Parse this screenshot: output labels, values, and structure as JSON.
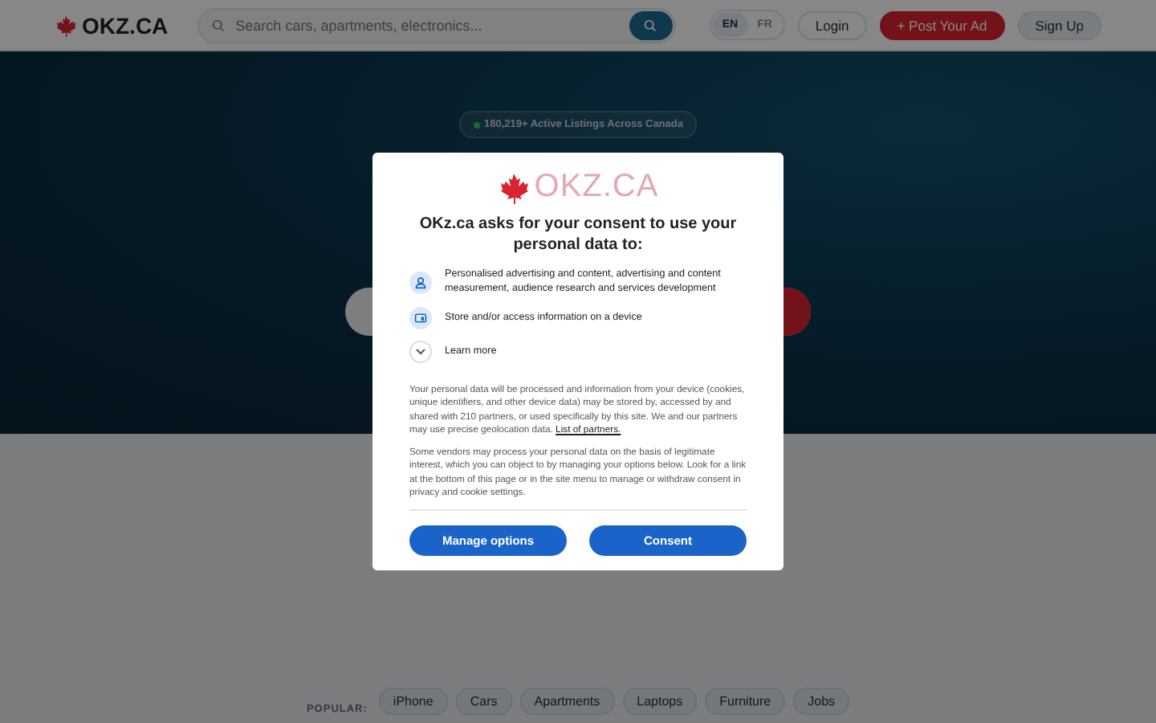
{
  "header": {
    "logo": "OKZ.CA",
    "search": {
      "placeholder": "Search cars, apartments, electronics..."
    },
    "languages": [
      {
        "label": "EN",
        "selected": true
      },
      {
        "label": "FR",
        "selected": false
      }
    ],
    "login": "Login",
    "post_ad": "+ Post Your Ad",
    "sign_up": "Sign Up"
  },
  "hero": {
    "badge": "180,219+ Active Listings Across Canada"
  },
  "popular": {
    "label": "POPULAR:",
    "tags": [
      "iPhone",
      "Cars",
      "Apartments",
      "Laptops",
      "Furniture",
      "Jobs"
    ]
  },
  "consent": {
    "logo": "OKZ.CA",
    "title": "OKz.ca asks for your consent to use your personal data to:",
    "purposes": [
      {
        "kind": "person",
        "text": "Personalised advertising and content, advertising and content measurement, audience research and services development"
      },
      {
        "kind": "device",
        "text": "Store and/or access information on a device"
      }
    ],
    "learn_more": "Learn more",
    "paragraph_1": "Your personal data will be processed and information from your device (cookies, unique identifiers, and other device data) may be stored by, accessed by and shared with 210 partners, or used specifically by this site. We and our partners may use precise geolocation data.",
    "partners_link": "List of partners.",
    "paragraph_2": "Some vendors may process your personal data on the basis of legitimate interest, which you can object to by managing your options below. Look for a link at the bottom of this page or in the site menu to manage or withdraw consent in privacy and cookie settings.",
    "buttons": [
      "Manage options",
      "Consent"
    ]
  }
}
